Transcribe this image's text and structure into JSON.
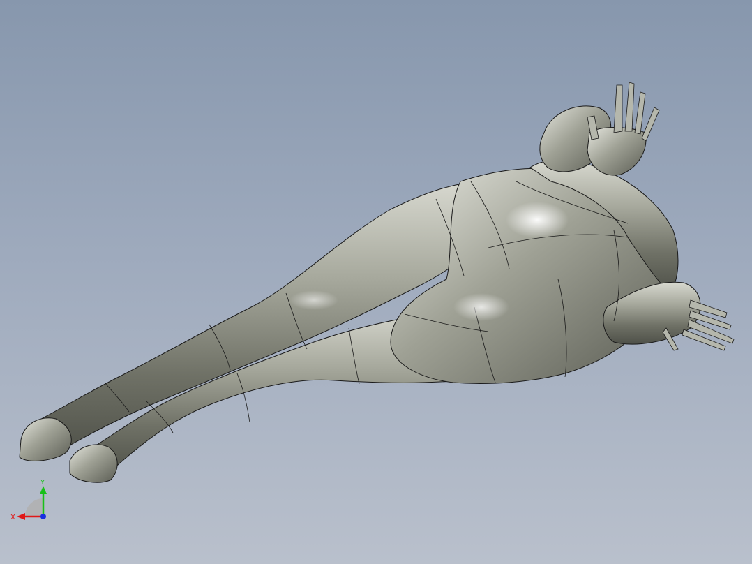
{
  "viewport": {
    "background_top": "#8797ad",
    "background_bottom": "#b9c0cc"
  },
  "model": {
    "material_color": "#a4a69a",
    "edge_color": "#1a1a1a"
  },
  "triad": {
    "x_label": "X",
    "y_label": "Y",
    "x_color": "#e01818",
    "y_color": "#18c018",
    "z_color": "#1830e0"
  }
}
